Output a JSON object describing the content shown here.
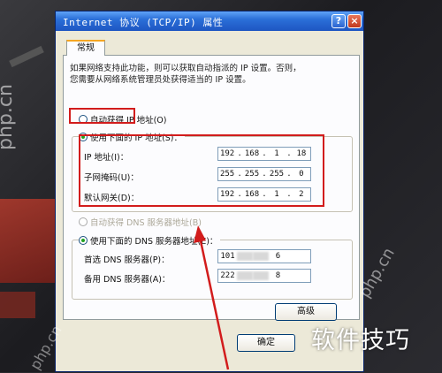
{
  "window": {
    "title": "Internet 协议 (TCP/IP) 属性",
    "help_glyph": "?",
    "close_glyph": "×",
    "tab_general": "常规"
  },
  "description": {
    "line1": "如果网络支持此功能，则可以获取自动指派的 IP 设置。否则，",
    "line2": "您需要从网络系统管理员处获得适当的 IP 设置。"
  },
  "ip_section": {
    "auto_label": "自动获得 IP 地址(O)",
    "manual_label": "使用下面的 IP 地址(S)：",
    "ip_address_label": "IP 地址(I)：",
    "subnet_label": "子网掩码(U)：",
    "gateway_label": "默认网关(D)：",
    "ip_address": [
      "192",
      "168",
      "1",
      "18"
    ],
    "subnet_mask": [
      "255",
      "255",
      "255",
      "0"
    ],
    "default_gateway": [
      "192",
      "168",
      "1",
      "2"
    ]
  },
  "dns_section": {
    "auto_label": "自动获得 DNS 服务器地址(B)",
    "manual_label": "使用下面的 DNS 服务器地址(E)：",
    "preferred_label": "首选 DNS 服务器(P)：",
    "alternate_label": "备用 DNS 服务器(A)：",
    "preferred_first": "101",
    "preferred_last": "6",
    "alternate_first": "222",
    "alternate_last": "8"
  },
  "buttons": {
    "advanced": "高级",
    "ok": "确定"
  },
  "watermarks": {
    "cn_text": "软件技巧",
    "php_left": "php.cn",
    "php_right": "php.cn",
    "php_bottom": "php.cn"
  },
  "colors": {
    "annotation_red": "#d21c1c",
    "titlebar_blue": "#2b6fd8",
    "radio_green": "#21a121"
  }
}
